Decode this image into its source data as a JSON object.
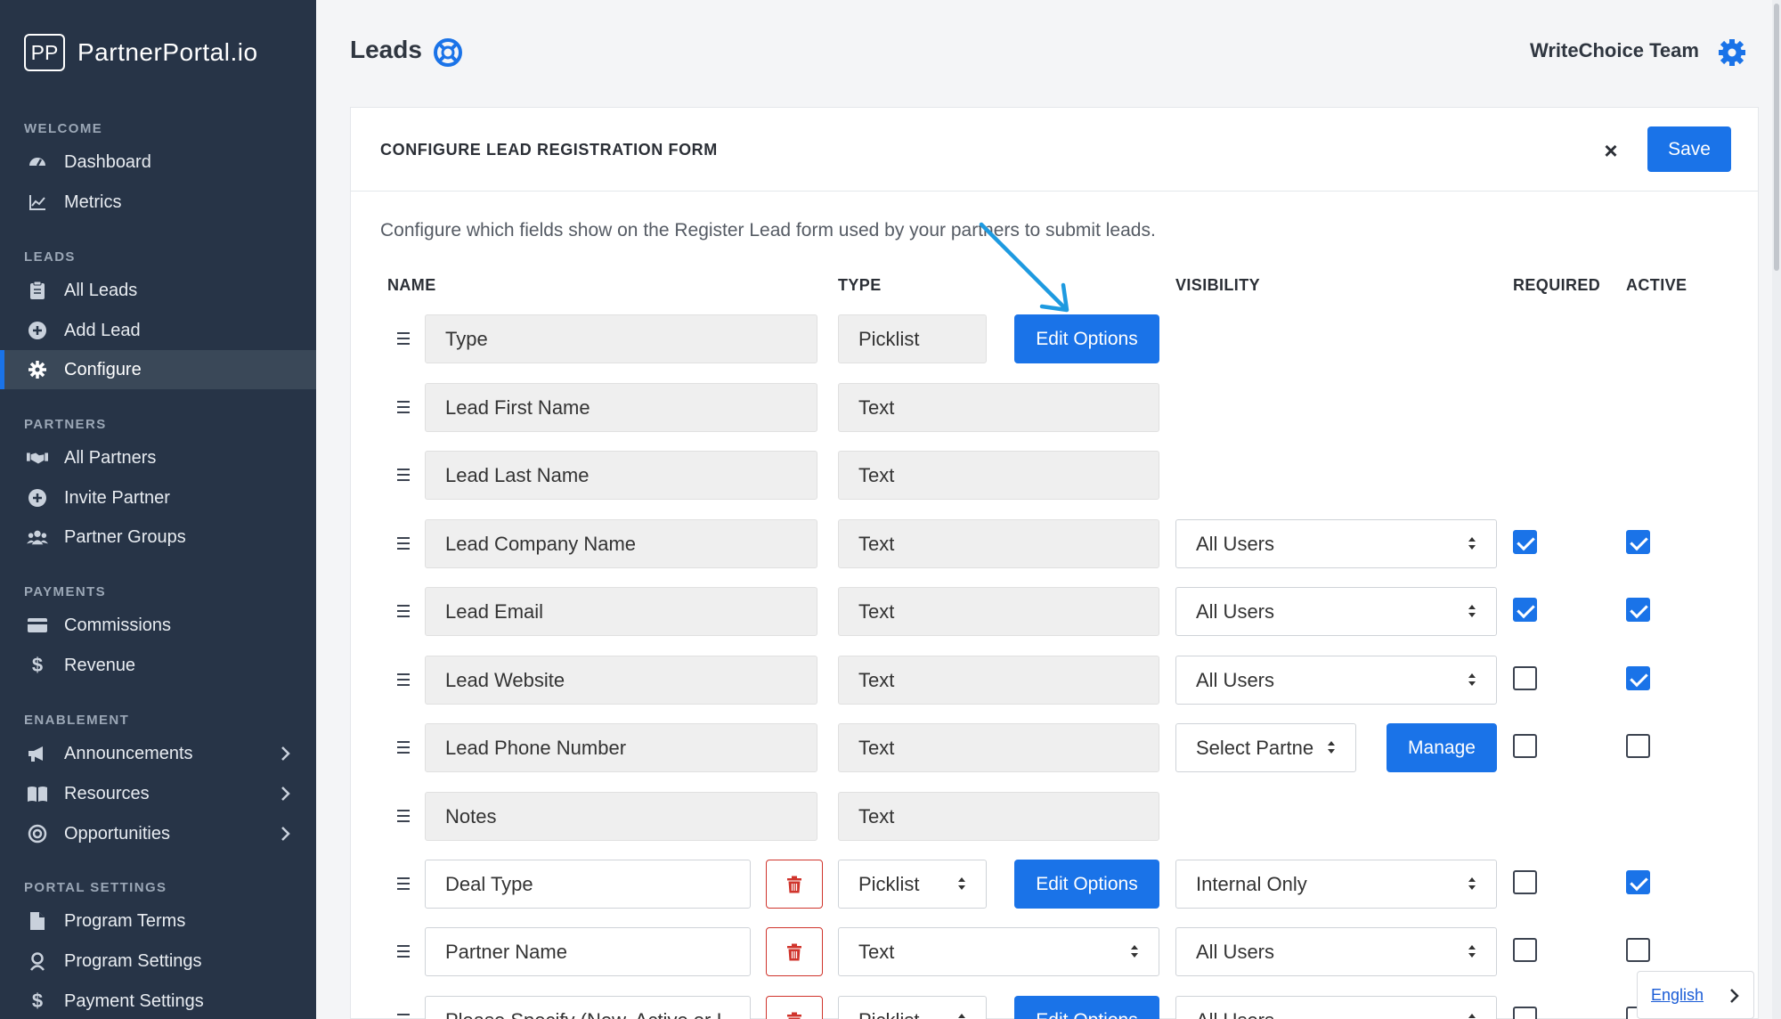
{
  "brand": {
    "logo": "PP",
    "name": "PartnerPortal.io"
  },
  "sidebar": {
    "sections": [
      {
        "label": "WELCOME",
        "items": [
          {
            "label": "Dashboard",
            "icon": "dashboard-icon"
          },
          {
            "label": "Metrics",
            "icon": "chart-line-icon"
          }
        ]
      },
      {
        "label": "LEADS",
        "items": [
          {
            "label": "All Leads",
            "icon": "clipboard-icon"
          },
          {
            "label": "Add Lead",
            "icon": "plus-circle-icon"
          },
          {
            "label": "Configure",
            "icon": "gear-icon",
            "active": true
          }
        ]
      },
      {
        "label": "PARTNERS",
        "items": [
          {
            "label": "All Partners",
            "icon": "handshake-icon"
          },
          {
            "label": "Invite Partner",
            "icon": "plus-circle-icon"
          },
          {
            "label": "Partner Groups",
            "icon": "users-icon"
          }
        ]
      },
      {
        "label": "PAYMENTS",
        "items": [
          {
            "label": "Commissions",
            "icon": "credit-card-icon"
          },
          {
            "label": "Revenue",
            "icon": "dollar-icon"
          }
        ]
      },
      {
        "label": "ENABLEMENT",
        "items": [
          {
            "label": "Announcements",
            "icon": "megaphone-icon"
          },
          {
            "label": "Resources",
            "icon": "book-icon"
          },
          {
            "label": "Opportunities",
            "icon": "target-icon"
          }
        ]
      },
      {
        "label": "PORTAL SETTINGS",
        "items": [
          {
            "label": "Program Terms",
            "icon": "file-icon"
          },
          {
            "label": "Program Settings",
            "icon": "user-settings-icon"
          },
          {
            "label": "Payment Settings",
            "icon": "dollar-icon"
          }
        ]
      }
    ]
  },
  "header": {
    "title": "Leads",
    "team": "WriteChoice Team"
  },
  "card": {
    "title": "CONFIGURE LEAD REGISTRATION FORM",
    "close": "×",
    "save": "Save",
    "description": "Configure which fields show on the Register Lead form used by your partners to submit leads.",
    "columns": {
      "name": "NAME",
      "type": "TYPE",
      "visibility": "VISIBILITY",
      "required": "REQUIRED",
      "active": "ACTIVE"
    },
    "rows": [
      {
        "name": "Type",
        "type": "Picklist",
        "action": "Edit Options"
      },
      {
        "name": "Lead First Name",
        "type": "Text"
      },
      {
        "name": "Lead Last Name",
        "type": "Text"
      },
      {
        "name": "Lead Company Name",
        "type": "Text",
        "visibility": "All Users",
        "required": true,
        "active": true
      },
      {
        "name": "Lead Email",
        "type": "Text",
        "visibility": "All Users",
        "required": true,
        "active": true
      },
      {
        "name": "Lead Website",
        "type": "Text",
        "visibility": "All Users",
        "required": false,
        "active": true
      },
      {
        "name": "Lead Phone Number",
        "type": "Text",
        "visibility": "Select Partne",
        "action": "Manage",
        "required": false,
        "active": false
      },
      {
        "name": "Notes",
        "type": "Text"
      },
      {
        "name": "Deal Type",
        "type": "Picklist",
        "action": "Edit Options",
        "visibility": "Internal Only",
        "required": false,
        "active": true
      },
      {
        "name": "Partner Name",
        "type": "Text",
        "visibility": "All Users",
        "required": false,
        "active": false
      },
      {
        "name": "Please Specify (New, Active or I",
        "type": "Picklist",
        "action": "Edit Options",
        "visibility": "All Users",
        "required": false,
        "active": false
      }
    ]
  },
  "language": "English",
  "colors": {
    "sidebar": "#273447",
    "accent": "#1a73e8",
    "danger": "#d0342c"
  }
}
